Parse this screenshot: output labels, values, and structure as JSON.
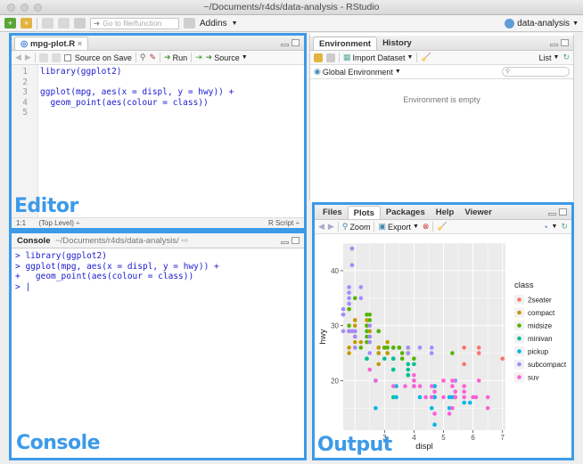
{
  "window": {
    "title": "~/Documents/r4ds/data-analysis - RStudio"
  },
  "main_toolbar": {
    "goto_placeholder": "Go to file/function",
    "addins_label": "Addins",
    "project_label": "data-analysis"
  },
  "editor": {
    "tab_label": "mpg-plot.R",
    "source_on_save_label": "Source on Save",
    "run_label": "Run",
    "source_label": "Source",
    "lines": [
      {
        "num": "1",
        "text": "library(ggplot2)"
      },
      {
        "num": "2",
        "text": ""
      },
      {
        "num": "3",
        "text": "ggplot(mpg, aes(x = displ, y = hwy)) +"
      },
      {
        "num": "4",
        "text": "  geom_point(aes(colour = class))"
      },
      {
        "num": "5",
        "text": ""
      }
    ],
    "status_pos": "1:1",
    "status_scope": "(Top Level) ÷",
    "status_type": "R Script ÷",
    "overlay_label": "Editor"
  },
  "console": {
    "tab_label": "Console",
    "path": "~/Documents/r4ds/data-analysis/",
    "lines": [
      "> library(ggplot2)",
      "> ggplot(mpg, aes(x = displ, y = hwy)) +",
      "+   geom_point(aes(colour = class))",
      "> |"
    ],
    "overlay_label": "Console"
  },
  "environment": {
    "tabs": [
      "Environment",
      "History"
    ],
    "import_label": "Import Dataset",
    "list_label": "List",
    "scope_label": "Global Environment",
    "empty_message": "Environment is empty"
  },
  "output": {
    "tabs": [
      "Files",
      "Plots",
      "Packages",
      "Help",
      "Viewer"
    ],
    "zoom_label": "Zoom",
    "export_label": "Export",
    "overlay_label": "Output"
  },
  "chart_data": {
    "type": "scatter",
    "xlabel": "displ",
    "ylabel": "hwy",
    "xlim": [
      1.6,
      7.1
    ],
    "ylim": [
      11,
      45
    ],
    "x_ticks": [
      3,
      4,
      5,
      6,
      7
    ],
    "y_ticks": [
      20,
      30,
      40
    ],
    "grid": true,
    "legend_position": "right",
    "legend_title": "class",
    "series": [
      {
        "name": "2seater",
        "color": "#F8766D",
        "points": [
          [
            5.7,
            26
          ],
          [
            5.7,
            23
          ],
          [
            6.2,
            26
          ],
          [
            6.2,
            25
          ],
          [
            7.0,
            24
          ]
        ]
      },
      {
        "name": "compact",
        "color": "#C49A00",
        "points": [
          [
            1.8,
            29
          ],
          [
            1.8,
            29
          ],
          [
            2.0,
            31
          ],
          [
            2.0,
            30
          ],
          [
            2.8,
            26
          ],
          [
            2.8,
            26
          ],
          [
            3.1,
            27
          ],
          [
            1.8,
            26
          ],
          [
            1.8,
            25
          ],
          [
            2.0,
            28
          ],
          [
            2.0,
            27
          ],
          [
            2.8,
            25
          ],
          [
            2.8,
            25
          ],
          [
            3.1,
            25
          ],
          [
            3.1,
            25
          ],
          [
            2.2,
            27
          ],
          [
            2.4,
            30
          ],
          [
            2.4,
            31
          ],
          [
            3.0,
            26
          ],
          [
            3.3,
            26
          ],
          [
            1.9,
            44
          ],
          [
            2.0,
            29
          ],
          [
            2.0,
            26
          ],
          [
            2.0,
            29
          ],
          [
            2.5,
            29
          ],
          [
            1.8,
            29
          ],
          [
            1.8,
            29
          ],
          [
            2.0,
            31
          ],
          [
            2.0,
            28
          ],
          [
            2.8,
            23
          ]
        ]
      },
      {
        "name": "midsize",
        "color": "#53B400",
        "points": [
          [
            2.4,
            32
          ],
          [
            2.4,
            27
          ],
          [
            3.1,
            26
          ],
          [
            3.5,
            26
          ],
          [
            3.6,
            25
          ],
          [
            2.4,
            29
          ],
          [
            2.5,
            28
          ],
          [
            3.5,
            26
          ],
          [
            3.0,
            26
          ],
          [
            3.8,
            26
          ],
          [
            3.8,
            25
          ],
          [
            4.0,
            24
          ],
          [
            2.4,
            30
          ],
          [
            2.4,
            28
          ],
          [
            2.5,
            31
          ],
          [
            2.5,
            32
          ],
          [
            3.3,
            26
          ],
          [
            3.3,
            26
          ],
          [
            1.8,
            30
          ],
          [
            1.8,
            33
          ],
          [
            2.0,
            35
          ],
          [
            2.8,
            29
          ],
          [
            2.8,
            29
          ],
          [
            3.6,
            24
          ],
          [
            3.8,
            21
          ],
          [
            2.2,
            26
          ],
          [
            2.4,
            24
          ],
          [
            3.0,
            26
          ],
          [
            3.5,
            26
          ],
          [
            5.3,
            25
          ]
        ]
      },
      {
        "name": "minivan",
        "color": "#00C094",
        "points": [
          [
            2.4,
            24
          ],
          [
            3.0,
            24
          ],
          [
            3.3,
            22
          ],
          [
            3.3,
            22
          ],
          [
            3.3,
            24
          ],
          [
            3.3,
            24
          ],
          [
            3.3,
            17
          ],
          [
            3.8,
            22
          ],
          [
            3.8,
            21
          ],
          [
            3.8,
            23
          ],
          [
            4.0,
            23
          ]
        ]
      },
      {
        "name": "pickup",
        "color": "#00B6EB",
        "points": [
          [
            2.7,
            20
          ],
          [
            2.7,
            15
          ],
          [
            2.7,
            20
          ],
          [
            3.4,
            17
          ],
          [
            3.4,
            19
          ],
          [
            4.0,
            19
          ],
          [
            4.7,
            17
          ],
          [
            4.7,
            12
          ],
          [
            4.7,
            17
          ],
          [
            5.2,
            17
          ],
          [
            5.2,
            15
          ],
          [
            5.7,
            16
          ],
          [
            5.9,
            16
          ],
          [
            4.7,
            19
          ],
          [
            4.7,
            19
          ],
          [
            5.3,
            17
          ],
          [
            4.2,
            17
          ],
          [
            4.6,
            15
          ],
          [
            5.4,
            17
          ],
          [
            5.4,
            17
          ]
        ]
      },
      {
        "name": "subcompact",
        "color": "#A58AFF",
        "points": [
          [
            1.6,
            33
          ],
          [
            1.6,
            32
          ],
          [
            1.6,
            32
          ],
          [
            1.6,
            29
          ],
          [
            1.8,
            29
          ],
          [
            1.8,
            34
          ],
          [
            1.8,
            36
          ],
          [
            1.9,
            44
          ],
          [
            1.9,
            41
          ],
          [
            1.9,
            29
          ],
          [
            2.0,
            26
          ],
          [
            2.0,
            28
          ],
          [
            2.0,
            29
          ],
          [
            2.5,
            27
          ],
          [
            2.5,
            25
          ],
          [
            3.8,
            26
          ],
          [
            3.8,
            25
          ],
          [
            4.2,
            26
          ],
          [
            5.4,
            20
          ],
          [
            5.4,
            20
          ],
          [
            4.6,
            26
          ],
          [
            4.6,
            25
          ],
          [
            2.5,
            28
          ],
          [
            2.5,
            30
          ],
          [
            2.2,
            37
          ],
          [
            2.2,
            35
          ],
          [
            1.8,
            37
          ],
          [
            1.8,
            35
          ]
        ]
      },
      {
        "name": "suv",
        "color": "#FB61D7",
        "points": [
          [
            2.7,
            20
          ],
          [
            4.0,
            19
          ],
          [
            4.0,
            20
          ],
          [
            4.6,
            17
          ],
          [
            5.0,
            17
          ],
          [
            5.4,
            17
          ],
          [
            5.4,
            18
          ],
          [
            5.3,
            20
          ],
          [
            5.3,
            15
          ],
          [
            5.7,
            17
          ],
          [
            6.0,
            17
          ],
          [
            6.5,
            17
          ],
          [
            4.6,
            19
          ],
          [
            5.4,
            17
          ],
          [
            4.2,
            19
          ],
          [
            4.0,
            19
          ],
          [
            4.7,
            18
          ],
          [
            5.7,
            19
          ],
          [
            6.1,
            17
          ],
          [
            4.0,
            20
          ],
          [
            3.7,
            19
          ],
          [
            4.7,
            14
          ],
          [
            5.2,
            14
          ],
          [
            5.3,
            19
          ],
          [
            6.2,
            20
          ],
          [
            6.5,
            15
          ],
          [
            5.7,
            18
          ],
          [
            4.4,
            17
          ],
          [
            3.3,
            19
          ],
          [
            2.5,
            22
          ],
          [
            5.0,
            20
          ],
          [
            4.0,
            21
          ]
        ]
      }
    ]
  }
}
